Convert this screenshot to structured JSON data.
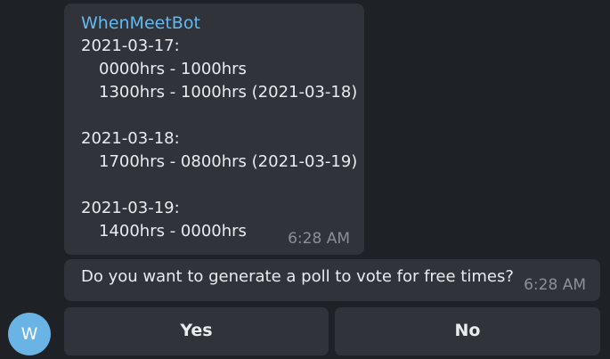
{
  "message_1": {
    "sender": "WhenMeetBot",
    "lines": [
      "2021-03-17:",
      "0000hrs - 1000hrs",
      "1300hrs - 1000hrs (2021-03-18)",
      "",
      "2021-03-18:",
      "1700hrs - 0800hrs (2021-03-19)",
      "",
      "2021-03-19:",
      "1400hrs - 0000hrs"
    ],
    "time": "6:28 AM"
  },
  "message_2": {
    "text": "Do you want to generate a poll to vote for free times?",
    "time": "6:28 AM"
  },
  "avatar": {
    "initial": "W",
    "color": "#6ab3e5"
  },
  "keyboard": {
    "yes_label": "Yes",
    "no_label": "No"
  },
  "colors": {
    "background": "#1e2125",
    "bubble": "#30343a",
    "sender_name": "#64b9ef",
    "timestamp": "#8b9096"
  }
}
